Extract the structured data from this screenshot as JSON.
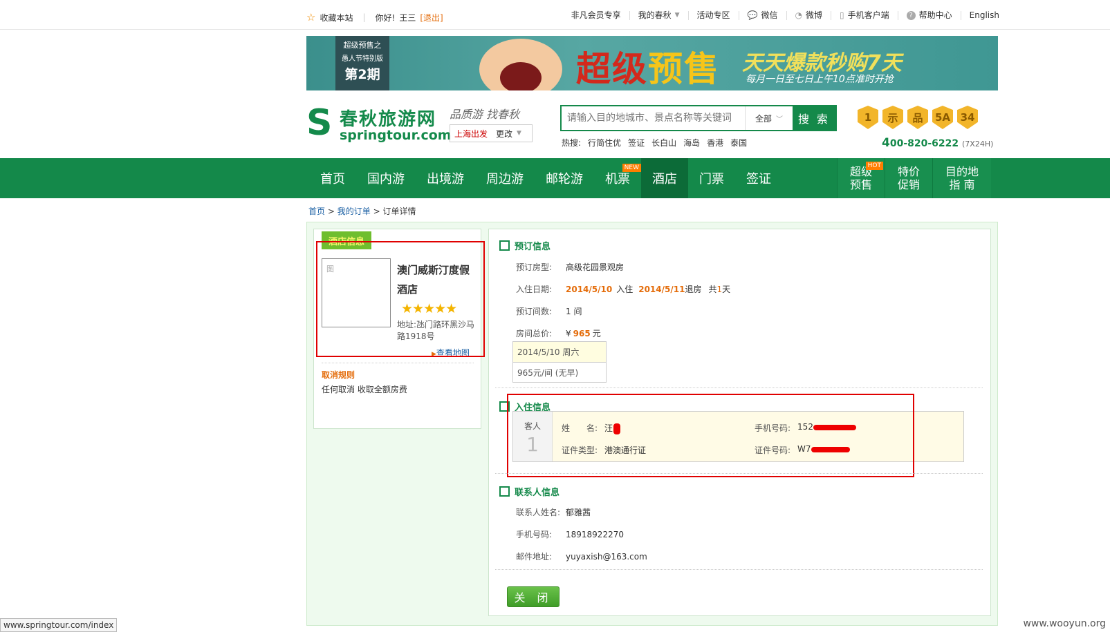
{
  "topbar": {
    "bookmark": "收藏本站",
    "greeting": "你好!",
    "username": "王三",
    "logout": "[退出]",
    "links": [
      "非凡会员专享",
      "我的春秋",
      "活动专区",
      "微信",
      "微博",
      "手机客户端",
      "帮助中心",
      "English"
    ]
  },
  "banner": {
    "tag_line1": "超级预售之",
    "tag_line2": "愚人节特别版",
    "tag_line3": "第2期",
    "headline_a": "超级",
    "headline_b": "预售",
    "sub1": "天天爆款秒购7天",
    "sub2": "每月一日至七日上午10点准时开抢"
  },
  "header": {
    "logo_cn": "春秋旅游网",
    "logo_en": "springtour.com",
    "slogan": "品质游 找春秋",
    "city": "上海出发",
    "city_change": "更改",
    "search_placeholder": "请输入目的地城市、景点名称等关键词",
    "search_scope": "全部",
    "search_button": "搜 索",
    "hot_label": "热搜:",
    "hot_terms": [
      "行简住优",
      "签证",
      "长白山",
      "海岛",
      "香港",
      "泰国"
    ],
    "badges": [
      "1",
      "示",
      "品",
      "5A",
      "34"
    ],
    "phone_prefix": "4",
    "phone": "00-820-6222",
    "phone_note": "(7X24H)"
  },
  "nav": {
    "items": [
      "首页",
      "国内游",
      "出境游",
      "周边游",
      "邮轮游",
      "机票",
      "酒店",
      "门票",
      "签证"
    ],
    "new_tag": "NEW",
    "hot_tag": "HOT",
    "right_items": [
      {
        "line1": "超级",
        "line2": "预售"
      },
      {
        "line1": "特价",
        "line2": "促销"
      },
      {
        "line1": "目的地",
        "line2": "指 南"
      }
    ]
  },
  "breadcrumb": {
    "home": "首页",
    "sep": ">",
    "orders": "我的订单",
    "current": "订单详情"
  },
  "hotel": {
    "section_title": "酒店信息",
    "image_alt": "图",
    "name": "澳门威斯汀度假酒店",
    "stars": "★★★★★",
    "address": "地址:氹门路环黑沙马路1918号",
    "map_link": "查看地图",
    "cancel_title": "取消规则",
    "cancel_desc": "任何取消 收取全额房费"
  },
  "booking": {
    "title": "预订信息",
    "room_type_label": "预订房型:",
    "room_type": "高级花园景观房",
    "date_label": "入住日期:",
    "checkin": "2014/5/10",
    "checkin_word": "入住",
    "checkout": "2014/5/11",
    "checkout_word": "退房",
    "total_prefix": "共",
    "nights": "1",
    "nights_unit": "天",
    "rooms_label": "预订间数:",
    "rooms": "1 间",
    "price_label": "房间总价:",
    "price_symbol": "¥",
    "price": "965",
    "price_unit": "元",
    "day_row": "2014/5/10 周六",
    "day_price": "965元/间 (无早)"
  },
  "guest": {
    "title": "入住信息",
    "guest_label": "客人",
    "guest_no": "1",
    "name_label": "姓　　名:",
    "name_visible": "汪",
    "mobile_label": "手机号码:",
    "mobile_visible": "152",
    "id_type_label": "证件类型:",
    "id_type": "港澳通行证",
    "id_no_label": "证件号码:",
    "id_no_visible": "W7"
  },
  "contact": {
    "title": "联系人信息",
    "name_label": "联系人姓名:",
    "name": "郁雅茜",
    "mobile_label": "手机号码:",
    "mobile": "18918922270",
    "email_label": "邮件地址:",
    "email": "yuyaxish@163.com"
  },
  "close_button": "关 闭",
  "statusbar": "www.springtour.com/index",
  "watermark": "www.wooyun.org",
  "colors": {
    "brand_green": "#14894a",
    "accent_orange": "#e46c0a",
    "highlight_red": "#e00000"
  }
}
